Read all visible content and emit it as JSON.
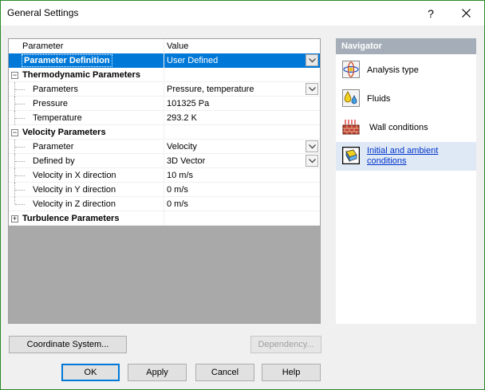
{
  "window": {
    "title": "General Settings",
    "help_label": "?",
    "close_label": "✕"
  },
  "grid": {
    "header": {
      "param": "Parameter",
      "value": "Value"
    },
    "rows": [
      {
        "param": "Parameter Definition",
        "value": "User Defined"
      },
      {
        "param": "Thermodynamic Parameters"
      },
      {
        "param": "Parameters",
        "value": "Pressure, temperature"
      },
      {
        "param": "Pressure",
        "value": "101325 Pa"
      },
      {
        "param": "Temperature",
        "value": "293.2 K"
      },
      {
        "param": "Velocity Parameters"
      },
      {
        "param": "Parameter",
        "value": "Velocity"
      },
      {
        "param": "Defined by",
        "value": "3D Vector"
      },
      {
        "param": "Velocity in X direction",
        "value": "10 m/s"
      },
      {
        "param": "Velocity in Y direction",
        "value": "0 m/s"
      },
      {
        "param": "Velocity in Z direction",
        "value": "0 m/s"
      },
      {
        "param": "Turbulence Parameters"
      }
    ],
    "expander_minus": "−",
    "expander_plus": "+"
  },
  "navigator": {
    "title": "Navigator",
    "items": [
      {
        "label": "Analysis type",
        "icon": "analysis-type-icon"
      },
      {
        "label": "Fluids",
        "icon": "fluids-icon"
      },
      {
        "label": "Wall conditions",
        "icon": "wall-conditions-icon"
      },
      {
        "label_line1": "Initial and ambient",
        "label_line2": "conditions",
        "icon": "initial-conditions-icon"
      }
    ]
  },
  "buttons": {
    "coordinate_system": "Coordinate System...",
    "dependency": "Dependency...",
    "ok": "OK",
    "apply": "Apply",
    "cancel": "Cancel",
    "help": "Help"
  },
  "colors": {
    "selection": "#0078d7",
    "navigator_header": "#a5aeb8",
    "link": "#0033cc"
  }
}
